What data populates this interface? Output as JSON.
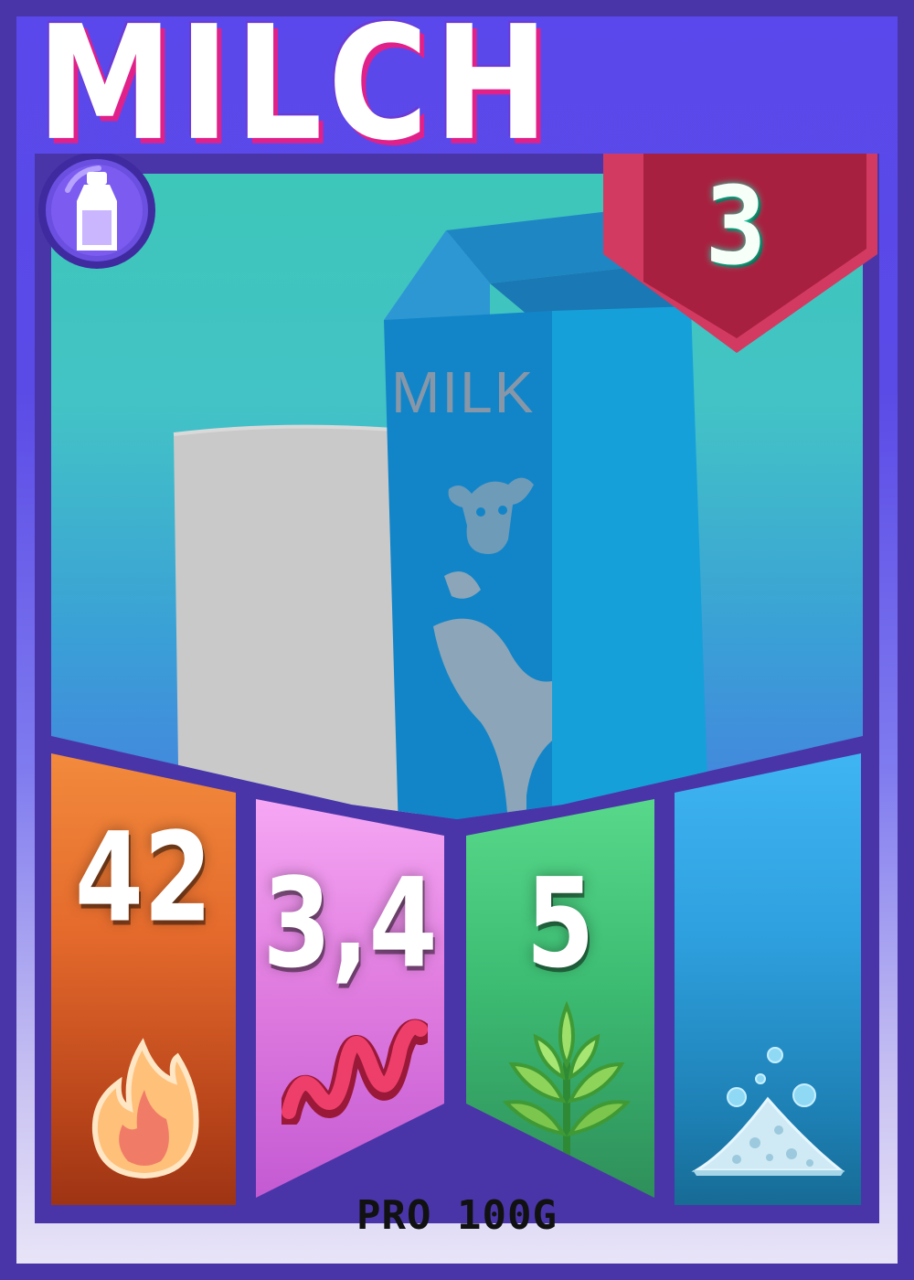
{
  "card": {
    "title": "MILCH",
    "cost": "3",
    "category_icon": "milk-bottle-icon",
    "illustration": {
      "carton_label": "MILK"
    },
    "stats": [
      {
        "name": "energy",
        "value": "42",
        "icon": "flame-icon",
        "color": "#e46a2c"
      },
      {
        "name": "fat",
        "value": "3,4",
        "icon": "ribbon-icon",
        "color": "#e17ee0"
      },
      {
        "name": "carbohydrates",
        "value": "5",
        "icon": "wheat-icon",
        "color": "#3dbd73"
      },
      {
        "name": "salt",
        "value": "",
        "icon": "salt-pile-icon",
        "color": "#2fa0df"
      }
    ],
    "footer": "PRO 100G"
  },
  "colors": {
    "frame": "#4a35a8",
    "header": "#5b48ec",
    "ribbon": "#a8203f",
    "title_shadow": "#e0218a"
  }
}
